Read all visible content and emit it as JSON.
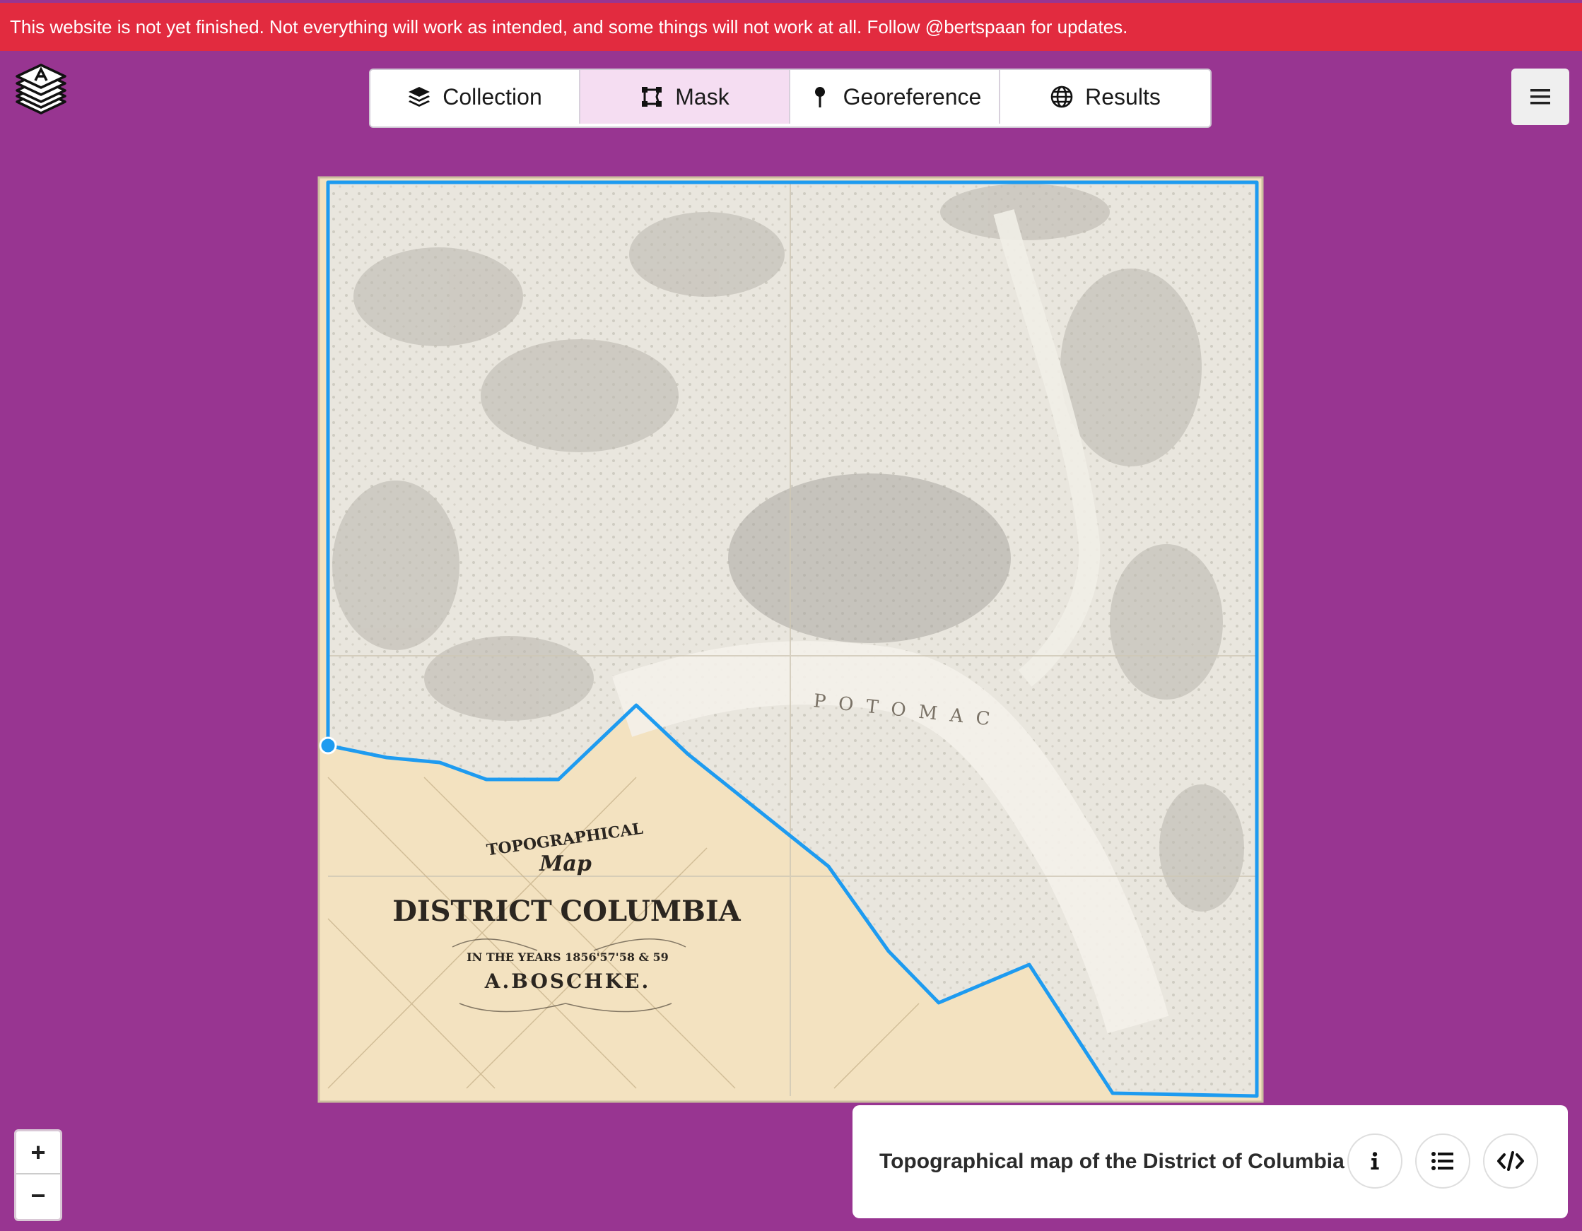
{
  "banner": {
    "text": "This website is not yet finished. Not everything will work as intended, and some things will not work at all. Follow @bertspaan for updates."
  },
  "steps": [
    {
      "label": "Collection",
      "icon": "layers-icon"
    },
    {
      "label": "Mask",
      "icon": "polygon-icon",
      "active": true
    },
    {
      "label": "Georeference",
      "icon": "pin-icon"
    },
    {
      "label": "Results",
      "icon": "globe-icon"
    }
  ],
  "map": {
    "cartouche": {
      "line1": "TOPOGRAPHICAL",
      "line2": "Map",
      "line3": "DISTRICT",
      "line3b": "COLUMBIA",
      "line4": "IN THE YEARS 1856'57'58 & 59",
      "line5": "A.BOSCHKE."
    },
    "river_label": "POTOMAC"
  },
  "zoom": {
    "in": "+",
    "out": "−"
  },
  "info": {
    "title": "Topographical map of the District of Columbia"
  },
  "colors": {
    "background": "#983591",
    "banner": "#e22b3f",
    "mask_line": "#1e9bf0",
    "active_step": "#f5ddf2"
  }
}
